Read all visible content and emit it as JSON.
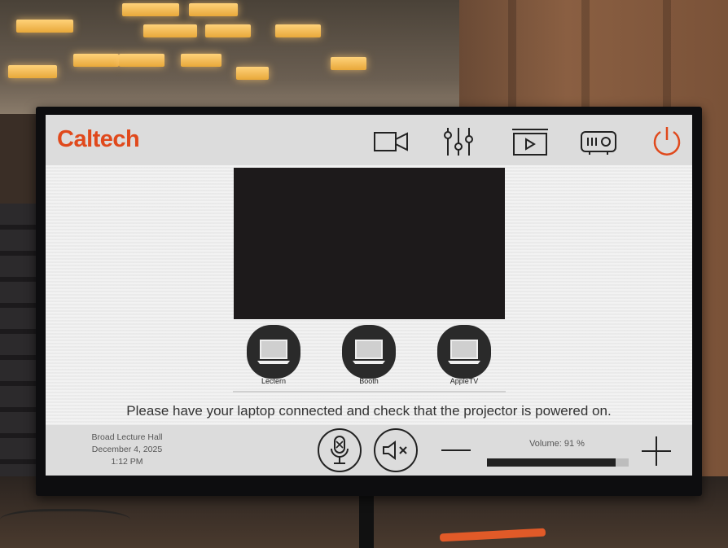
{
  "header": {
    "logo": "Caltech",
    "icons": [
      "camera-icon",
      "mixer-sliders-icon",
      "media-play-icon",
      "projector-icon",
      "power-icon"
    ]
  },
  "sources": [
    {
      "label": "Lectern"
    },
    {
      "label": "Booth"
    },
    {
      "label": "AppleTV"
    }
  ],
  "message": "Please have your laptop connected and check that the projector is powered on.",
  "footer": {
    "room": "Broad Lecture Hall",
    "date": "December 4, 2025",
    "time": "1:12 PM"
  },
  "volume": {
    "label": "Volume: 91 %",
    "level": 0.91
  },
  "colors": {
    "accent": "#e0491c",
    "bar": "#dcdcdc",
    "screen": "#f2f2f2"
  }
}
